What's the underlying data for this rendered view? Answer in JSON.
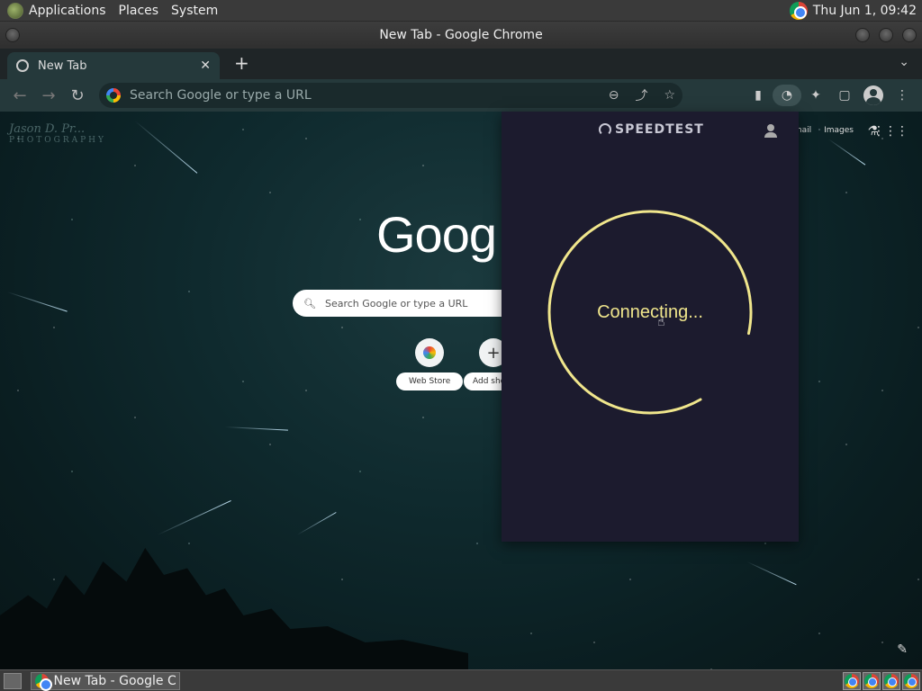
{
  "top_panel": {
    "menus": [
      "Applications",
      "Places",
      "System"
    ],
    "clock": "Thu Jun  1, 09:42"
  },
  "window": {
    "title": "New Tab - Google Chrome"
  },
  "tabs": [
    {
      "label": "New Tab",
      "close": "✕"
    }
  ],
  "newtab_symbol": "+",
  "toolbar": {
    "back": "←",
    "forward": "→",
    "reload": "↻",
    "omnibox_placeholder": "Search Google or type a URL",
    "zoom": "⊖",
    "share": "⤴",
    "star": "☆",
    "menu": "⋮"
  },
  "ntp": {
    "watermark": "Jason D. Pr...",
    "watermark_sub": "PHOTOGRAPHY",
    "google_text": "Goog",
    "search_placeholder": "Search Google or type a URL",
    "shortcuts": [
      {
        "label": "Web Store",
        "icon": "webstore-icon"
      },
      {
        "label": "Add sho",
        "icon": "+"
      }
    ],
    "top_links": [
      "Gmail",
      "Images"
    ],
    "labs": "⚗",
    "apps": "⋮⋮⋮",
    "customize": "✎"
  },
  "speedtest": {
    "brand": "SPEEDTEST",
    "status": "Connecting..."
  },
  "taskbar": {
    "task_label": "New Tab - Google C...",
    "tray_count": 4
  }
}
